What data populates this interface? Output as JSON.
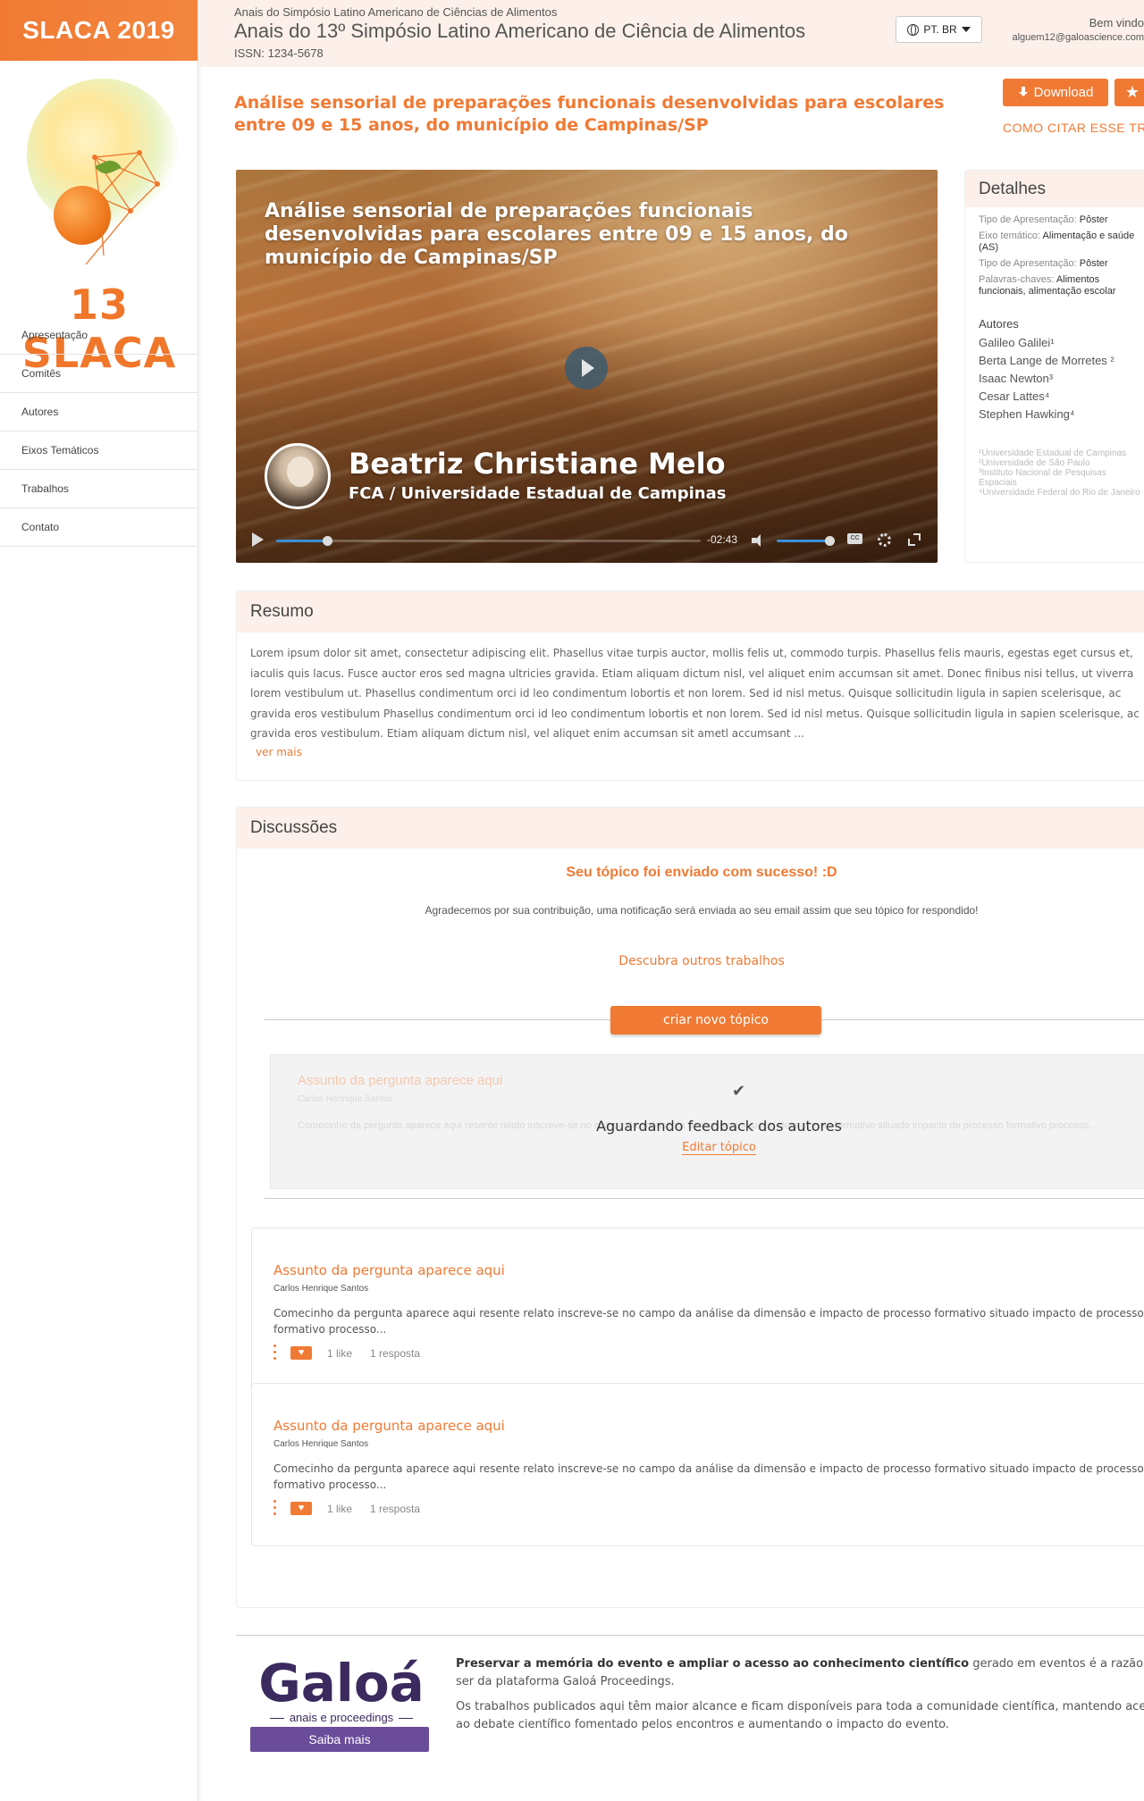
{
  "sidebar": {
    "brand": "SLACA 2019",
    "logo_text": "13 SLACA",
    "nav": [
      {
        "label": "Apresentação"
      },
      {
        "label": "Comitês"
      },
      {
        "label": "Autores"
      },
      {
        "label": "Eixos Temáticos"
      },
      {
        "label": "Trabalhos"
      },
      {
        "label": "Contato"
      }
    ]
  },
  "header": {
    "supertitle": "Anais do Simpósio Latino Americano de Ciências de Alimentos",
    "title": "Anais do 13º Simpósio Latino Americano de Ciência de Alimentos",
    "issn": "ISSN: 1234-5678",
    "language": "PT. BR",
    "welcome": "Bem vindo",
    "email": "alguem12@galoascience.com"
  },
  "paper": {
    "title": "Análise sensorial de preparações funcionais desenvolvidas para escolares entre 09 e 15 anos, do município de Campinas/SP",
    "download_label": "Download",
    "cite_label": "COMO CITAR ESSE TRABALHO"
  },
  "video": {
    "title": "Análise sensorial de preparações funcionais desenvolvidas para escolares entre 09 e 15 anos, do município de Campinas/SP",
    "speaker": "Beatriz Christiane Melo",
    "affiliation": "FCA / Universidade Estadual de Campinas",
    "time_remaining": "-02:43",
    "progress": 0.12,
    "volume": 1.0,
    "cc_label": "CC"
  },
  "details": {
    "heading": "Detalhes",
    "rows": [
      {
        "label": "Tipo de Apresentação:",
        "value": "Pôster"
      },
      {
        "label": "Eixo temático:",
        "value": "Alimentação e saúde (AS)"
      },
      {
        "label": "Tipo de Apresentação:",
        "value": "Pôster"
      },
      {
        "label": "Palavras-chaves:",
        "value": "Alimentos funcionais, alimentação escolar"
      }
    ],
    "authors_heading": "Autores",
    "authors": [
      "Galileo Galilei¹",
      "Berta Lange de Morretes ²",
      "Isaac Newton³",
      "Cesar Lattes⁴",
      "Stephen Hawking⁴"
    ],
    "institutions": [
      "¹Universidade Estadual de Campinas",
      "²Universidade de São Paulo",
      "³Instituto Nacional de Pesquisas Espaciais",
      "⁴Universidade Federal do Rio de Janeiro"
    ]
  },
  "resumo": {
    "heading": "Resumo",
    "text": "Lorem ipsum dolor sit amet, consectetur adipiscing elit. Phasellus vitae turpis auctor, mollis felis ut, commodo turpis. Phasellus felis mauris, egestas eget cursus et, iaculis quis lacus. Fusce auctor eros sed magna ultricies gravida. Etiam aliquam dictum nisl, vel aliquet enim accumsan sit amet. Donec finibus nisi tellus, ut viverra lorem vestibulum ut. Phasellus condimentum orci id leo condimentum lobortis et non lorem. Sed id nisl metus. Quisque sollicitudin ligula in sapien scelerisque, ac gravida eros vestibulum Phasellus condimentum orci id leo condimentum lobortis et non lorem. Sed id nisl metus. Quisque sollicitudin ligula in sapien scelerisque, ac gravida eros vestibulum. Etiam aliquam dictum nisl, vel aliquet enim accumsan sit ametl accumsant ...",
    "more_label": "ver mais"
  },
  "discussions": {
    "heading": "Discussões",
    "success_title": "Seu tópico foi enviado com sucesso! :D",
    "success_text": "Agradecemos por sua contribuição, uma notificação será enviada ao seu email assim que seu tópico for respondido!",
    "discover_label": "Descubra outros trabalhos",
    "new_topic_label": "criar novo tópico",
    "pending": {
      "title": "Assunto da pergunta aparece aqui",
      "author": "Carlos Henrique Santos",
      "body": "Comecinho da pergunta aparece aqui resente relato inscreve-se no campo da análise da dimensão e impacto de processo formativo situado impacto de processo formativo processo...",
      "status": "Aguardando feedback dos autores",
      "edit_label": "Editar tópico"
    },
    "topics": [
      {
        "title": "Assunto da pergunta aparece aqui",
        "author": "Carlos Henrique Santos",
        "body": "Comecinho da pergunta aparece aqui resente relato inscreve-se no campo da análise da dimensão e impacto de processo formativo situado impacto de processo formativo processo...",
        "likes": "1 like",
        "replies": "1 resposta"
      },
      {
        "title": "Assunto da pergunta aparece aqui",
        "author": "Carlos Henrique Santos",
        "body": "Comecinho da pergunta aparece aqui resente relato inscreve-se no campo da análise da dimensão e impacto de processo formativo situado impacto de processo formativo processo...",
        "likes": "1 like",
        "replies": "1 resposta"
      }
    ]
  },
  "footer": {
    "logo_word": "Galoá",
    "logo_sub": "anais e proceedings",
    "cta_label": "Saiba mais",
    "p1_bold": "Preservar a memória do evento e ampliar o acesso ao conhecimento científico",
    "p1_rest": " gerado em eventos é a razão de ser da plataforma Galoá Proceedings.",
    "p2": "Os trabalhos publicados aqui têm maior alcance e ficam disponíveis para toda a comunidade científica, mantendo acesso ao debate científico fomentado pelos encontros e aumentando o impacto do evento."
  },
  "colors": {
    "accent": "#f07a34",
    "header_bg": "#fdf0ea",
    "galoa_purple": "#6b4c9a"
  }
}
